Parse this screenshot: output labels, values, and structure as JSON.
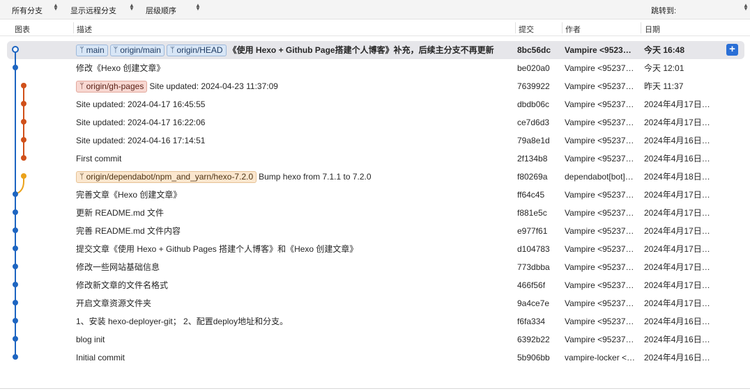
{
  "toolbar": {
    "branch_filter": "所有分支",
    "remote_branches": "显示远程分支",
    "order": "层级顺序",
    "jump_to": "跳转到:"
  },
  "columns": {
    "graph": "图表",
    "description": "描述",
    "commit": "提交",
    "author": "作者",
    "date": "日期"
  },
  "colors": {
    "main_lane": "#1d65c1",
    "gh_pages_lane": "#d0501a",
    "dependabot_lane": "#eba21b",
    "selection": "#e6e6ea",
    "accent": "#2a6fd6"
  },
  "commits": [
    {
      "tags": [
        {
          "label": "main",
          "style": "blue"
        },
        {
          "label": "origin/main",
          "style": "blue"
        },
        {
          "label": "origin/HEAD",
          "style": "blue"
        }
      ],
      "message": "《使用 Hexo + Github Page搭建个人博客》补充，后续主分支不再更新",
      "hash": "8bc56dc",
      "author": "Vampire <9523…",
      "date": "今天 16:48",
      "lane": 0,
      "selected": true
    },
    {
      "tags": [],
      "message": "修改《Hexo 创建文章》",
      "hash": "be020a0",
      "author": "Vampire <95237…",
      "date": "今天 12:01",
      "lane": 0
    },
    {
      "tags": [
        {
          "label": "origin/gh-pages",
          "style": "red"
        }
      ],
      "message": "Site updated: 2024-04-23 11:37:09",
      "hash": "7639922",
      "author": "Vampire <95237…",
      "date": "昨天 11:37",
      "lane": 1
    },
    {
      "tags": [],
      "message": "Site updated: 2024-04-17 16:45:55",
      "hash": "dbdb06c",
      "author": "Vampire <95237…",
      "date": "2024年4月17日…",
      "lane": 1
    },
    {
      "tags": [],
      "message": "Site updated: 2024-04-17 16:22:06",
      "hash": "ce7d6d3",
      "author": "Vampire <95237…",
      "date": "2024年4月17日…",
      "lane": 1
    },
    {
      "tags": [],
      "message": "Site updated: 2024-04-16 17:14:51",
      "hash": "79a8e1d",
      "author": "Vampire <95237…",
      "date": "2024年4月16日…",
      "lane": 1
    },
    {
      "tags": [],
      "message": "First commit",
      "hash": "2f134b8",
      "author": "Vampire <95237…",
      "date": "2024年4月16日…",
      "lane": 1
    },
    {
      "tags": [
        {
          "label": "origin/dependabot/npm_and_yarn/hexo-7.2.0",
          "style": "orange"
        }
      ],
      "message": "Bump hexo from 7.1.1 to 7.2.0",
      "hash": "f80269a",
      "author": "dependabot[bot]…",
      "date": "2024年4月18日…",
      "lane": 2
    },
    {
      "tags": [],
      "message": "完善文章《Hexo 创建文章》",
      "hash": "ff64c45",
      "author": "Vampire <95237…",
      "date": "2024年4月17日…",
      "lane": 0
    },
    {
      "tags": [],
      "message": "更新 README.md 文件",
      "hash": "f881e5c",
      "author": "Vampire <95237…",
      "date": "2024年4月17日…",
      "lane": 0
    },
    {
      "tags": [],
      "message": "完善 README.md 文件内容",
      "hash": "e977f61",
      "author": "Vampire <95237…",
      "date": "2024年4月17日…",
      "lane": 0
    },
    {
      "tags": [],
      "message": "提交文章《使用 Hexo + Github Pages 搭建个人博客》和《Hexo 创建文章》",
      "hash": "d104783",
      "author": "Vampire <95237…",
      "date": "2024年4月17日…",
      "lane": 0
    },
    {
      "tags": [],
      "message": "修改一些网站基础信息",
      "hash": "773dbba",
      "author": "Vampire <95237…",
      "date": "2024年4月17日…",
      "lane": 0
    },
    {
      "tags": [],
      "message": "修改新文章的文件名格式",
      "hash": "466f56f",
      "author": "Vampire <95237…",
      "date": "2024年4月17日…",
      "lane": 0
    },
    {
      "tags": [],
      "message": "开启文章资源文件夹",
      "hash": "9a4ce7e",
      "author": "Vampire <95237…",
      "date": "2024年4月17日…",
      "lane": 0
    },
    {
      "tags": [],
      "message": "1、安装 hexo-deployer-git； 2、配置deploy地址和分支。",
      "hash": "f6fa334",
      "author": "Vampire <95237…",
      "date": "2024年4月16日…",
      "lane": 0
    },
    {
      "tags": [],
      "message": "blog init",
      "hash": "6392b22",
      "author": "Vampire <95237…",
      "date": "2024年4月16日…",
      "lane": 0
    },
    {
      "tags": [],
      "message": "Initial commit",
      "hash": "5b906bb",
      "author": "vampire-locker <…",
      "date": "2024年4月16日…",
      "lane": 0
    }
  ]
}
